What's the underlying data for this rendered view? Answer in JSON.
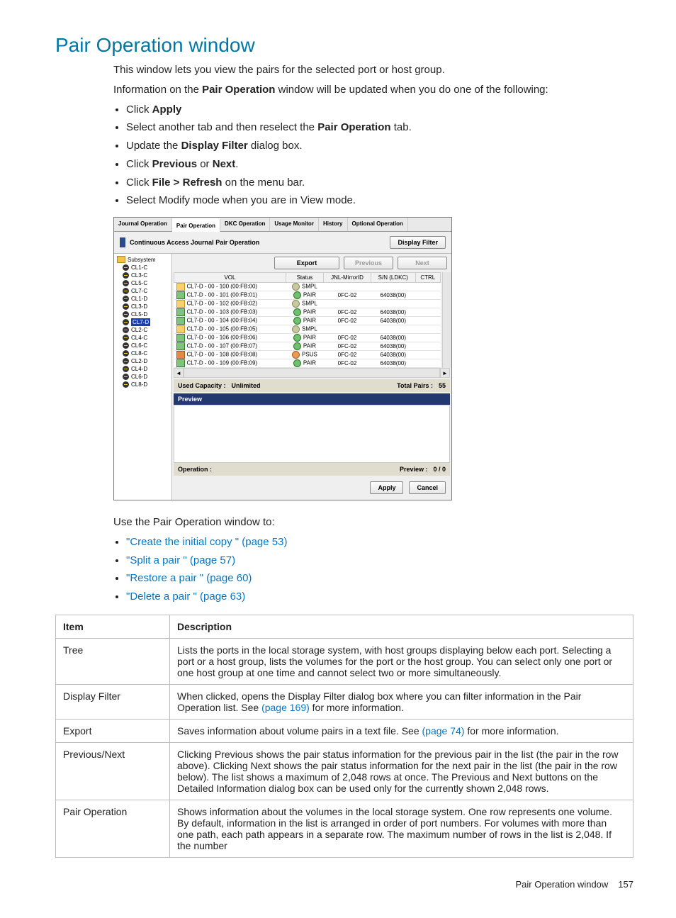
{
  "title": "Pair Operation window",
  "intro1": "This window lets you view the pairs for the selected port or host group.",
  "intro2_pre": "Information on the ",
  "intro2_bold": "Pair Operation",
  "intro2_post": " window will be updated when you do one of the following:",
  "bullets_top": {
    "b1_pre": "Click ",
    "b1_bold": "Apply",
    "b2_pre": "Select another tab and then reselect the ",
    "b2_bold": "Pair Operation",
    "b2_post": " tab.",
    "b3_pre": "Update the ",
    "b3_bold": "Display Filter",
    "b3_post": " dialog box.",
    "b4_pre": "Click ",
    "b4_bold1": "Previous",
    "b4_mid": " or ",
    "b4_bold2": "Next",
    "b4_post": ".",
    "b5_pre": "Click ",
    "b5_bold": "File > Refresh",
    "b5_post": " on the menu bar.",
    "b6": "Select Modify mode when you are in View mode."
  },
  "mock": {
    "tabs": [
      "Journal Operation",
      "Pair Operation",
      "DKC Operation",
      "Usage Monitor",
      "History",
      "Optional Operation"
    ],
    "active_tab_index": 1,
    "bar_title": "Continuous Access Journal Pair Operation",
    "display_filter_btn": "Display Filter",
    "tree_root": "Subsystem",
    "tree_selected_index": 7,
    "tree_nodes": [
      "CL1-C",
      "CL3-C",
      "CL5-C",
      "CL7-C",
      "CL1-D",
      "CL3-D",
      "CL5-D",
      "CL7-D",
      "CL2-C",
      "CL4-C",
      "CL6-C",
      "CL8-C",
      "CL2-D",
      "CL4-D",
      "CL6-D",
      "CL8-D"
    ],
    "export_btn": "Export",
    "prev_btn": "Previous",
    "next_btn": "Next",
    "columns": [
      "VOL",
      "Status",
      "JNL-MirrorID",
      "S/N (LDKC)",
      "CTRL"
    ],
    "rows": [
      {
        "vol": "CL7-D - 00 - 100 (00:FB:00)",
        "status": "SMPL",
        "jnl": "",
        "sn": "",
        "ctrl": ""
      },
      {
        "vol": "CL7-D - 00 - 101 (00:FB:01)",
        "status": "PAIR",
        "jnl": "0FC-02",
        "sn": "64038(00)",
        "ctrl": ""
      },
      {
        "vol": "CL7-D - 00 - 102 (00:FB:02)",
        "status": "SMPL",
        "jnl": "",
        "sn": "",
        "ctrl": ""
      },
      {
        "vol": "CL7-D - 00 - 103 (00:FB:03)",
        "status": "PAIR",
        "jnl": "0FC-02",
        "sn": "64038(00)",
        "ctrl": ""
      },
      {
        "vol": "CL7-D - 00 - 104 (00:FB:04)",
        "status": "PAIR",
        "jnl": "0FC-02",
        "sn": "64038(00)",
        "ctrl": ""
      },
      {
        "vol": "CL7-D - 00 - 105 (00:FB:05)",
        "status": "SMPL",
        "jnl": "",
        "sn": "",
        "ctrl": ""
      },
      {
        "vol": "CL7-D - 00 - 106 (00:FB:06)",
        "status": "PAIR",
        "jnl": "0FC-02",
        "sn": "64038(00)",
        "ctrl": ""
      },
      {
        "vol": "CL7-D - 00 - 107 (00:FB:07)",
        "status": "PAIR",
        "jnl": "0FC-02",
        "sn": "64038(00)",
        "ctrl": ""
      },
      {
        "vol": "CL7-D - 00 - 108 (00:FB:08)",
        "status": "PSUS",
        "jnl": "0FC-02",
        "sn": "64038(00)",
        "ctrl": ""
      },
      {
        "vol": "CL7-D - 00 - 109 (00:FB:09)",
        "status": "PAIR",
        "jnl": "0FC-02",
        "sn": "64038(00)",
        "ctrl": ""
      }
    ],
    "used_cap_label": "Used Capacity :",
    "used_cap_value": "Unlimited",
    "total_pairs_label": "Total Pairs :",
    "total_pairs_value": "55",
    "preview_head": "Preview",
    "operation_label": "Operation :",
    "preview_label": "Preview :",
    "preview_value": "0 / 0",
    "apply_btn": "Apply",
    "cancel_btn": "Cancel"
  },
  "use_line": "Use the Pair Operation window to:",
  "use_links": {
    "l1_text": "\"Create the initial copy \" (page 53)",
    "l2_text": "\"Split a pair \" (page 57)",
    "l3_text": "\"Restore a pair \" (page 60)",
    "l4_text": "\"Delete a pair \" (page 63)"
  },
  "table": {
    "h1": "Item",
    "h2": "Description",
    "r1_item": "Tree",
    "r1_desc": "Lists the ports in the local storage system, with host groups displaying below each port. Selecting a port or a host group, lists the volumes for the port or the host group. You can select only one port or one host group at one time and cannot select two or more simultaneously.",
    "r2_item": "Display Filter",
    "r2_pre": "When clicked, opens the Display Filter dialog box where you can filter information in the Pair Operation list. See ",
    "r2_link": "(page 169)",
    "r2_post": " for more information.",
    "r3_item": "Export",
    "r3_pre": "Saves information about volume pairs in a text file. See ",
    "r3_link": "(page 74)",
    "r3_post": " for more information.",
    "r4_item": "Previous/Next",
    "r4_desc": "Clicking Previous shows the pair status information for the previous pair in the list (the pair in the row above). Clicking Next shows the pair status information for the next pair in the list (the pair in the row below). The list shows a maximum of 2,048 rows at once. The Previous and Next buttons on the Detailed Information dialog box can be used only for the currently shown 2,048 rows.",
    "r5_item": "Pair Operation",
    "r5_desc": "Shows information about the volumes in the local storage system. One row represents one volume. By default, information in the list is arranged in order of port numbers. For volumes with more than one path, each path appears in a separate row. The maximum number of rows in the list is 2,048. If the number"
  },
  "footer": {
    "label": "Pair Operation window",
    "page": "157"
  }
}
